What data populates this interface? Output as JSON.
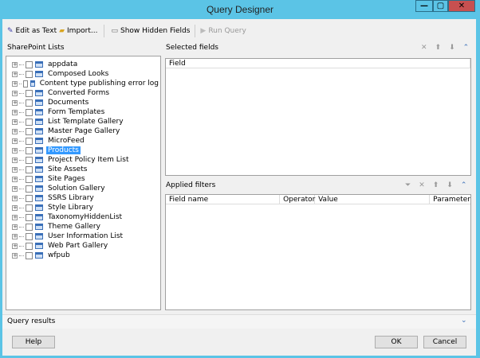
{
  "window": {
    "title": "Query Designer",
    "minimize": "—",
    "maximize": "▢",
    "close": "✕"
  },
  "toolbar": {
    "edit_as_text": "Edit as Text",
    "import": "Import...",
    "show_hidden_fields": "Show Hidden Fields",
    "run_query": "Run Query"
  },
  "left": {
    "header": "SharePoint Lists",
    "items": [
      "appdata",
      "Composed Looks",
      "Content type publishing error log",
      "Converted Forms",
      "Documents",
      "Form Templates",
      "List Template Gallery",
      "Master Page Gallery",
      "MicroFeed",
      "Products",
      "Project Policy Item List",
      "Site Assets",
      "Site Pages",
      "Solution Gallery",
      "SSRS Library",
      "Style Library",
      "TaxonomyHiddenList",
      "Theme Gallery",
      "User Information List",
      "Web Part Gallery",
      "wfpub"
    ],
    "selected": "Products"
  },
  "selected_fields": {
    "header": "Selected fields",
    "columns": [
      "Field"
    ]
  },
  "applied_filters": {
    "header": "Applied filters",
    "columns": [
      "Field name",
      "Operator",
      "Value",
      "Parameter"
    ]
  },
  "query_results": {
    "header": "Query results"
  },
  "buttons": {
    "help": "Help",
    "ok": "OK",
    "cancel": "Cancel"
  }
}
